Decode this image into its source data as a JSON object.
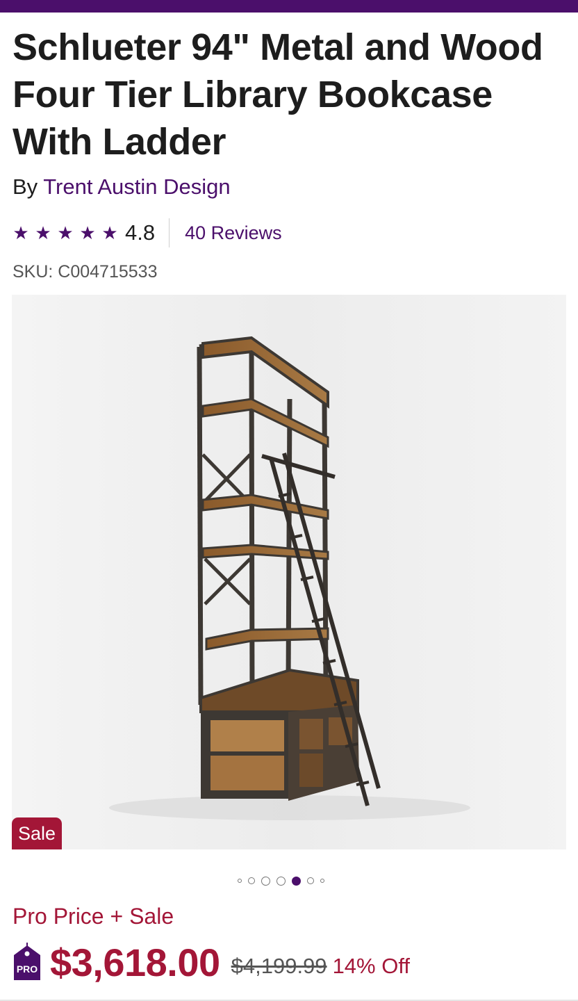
{
  "product": {
    "title": "Schlueter 94\" Metal and Wood Four Tier Library Bookcase With Ladder",
    "by_label": "By ",
    "brand": "Trent Austin Design",
    "rating_value": "4.8",
    "rating_stars": 4.8,
    "reviews": "40 Reviews",
    "sku": "SKU: C004715533"
  },
  "gallery": {
    "badge": "Sale",
    "image_icon": "bookcase-with-ladder-photo",
    "active_index": 4,
    "dot_count": 7
  },
  "pricing": {
    "label": "Pro Price + Sale",
    "pro_badge": "PRO",
    "price": "$3,618.00",
    "was_price": "$4,199.99",
    "discount": "14% Off"
  },
  "colors": {
    "brand_purple": "#4b0f6b",
    "sale_red": "#a31637"
  }
}
